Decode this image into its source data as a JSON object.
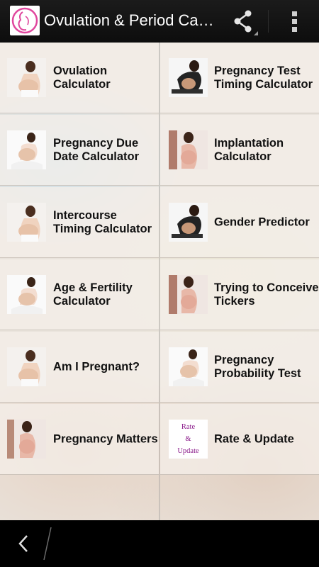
{
  "app": {
    "title": "Ovulation & Period Calculator",
    "icons": {
      "app": "pregnant-woman-logo-icon",
      "share": "share-icon",
      "overflow": "overflow-menu-icon",
      "back": "back-icon"
    }
  },
  "menu": {
    "items": [
      {
        "label": "Ovulation Calculator",
        "thumb": "pregnant-woman-photo"
      },
      {
        "label": "Pregnancy Test Timing Calculator",
        "thumb": "pregnant-woman-dark-photo"
      },
      {
        "label": "Pregnancy Due Date Calculator",
        "thumb": "pregnant-woman-sitting-photo"
      },
      {
        "label": "Implantation Calculator",
        "thumb": "pregnant-woman-photo"
      },
      {
        "label": "Intercourse Timing Calculator",
        "thumb": "pregnant-woman-photo"
      },
      {
        "label": "Gender Predictor",
        "thumb": "pregnant-woman-dark-photo"
      },
      {
        "label": "Age & Fertility Calculator",
        "thumb": "pregnant-woman-sitting-photo"
      },
      {
        "label": "Trying to Conceive Tickers",
        "thumb": "pregnant-woman-photo"
      },
      {
        "label": "Am I Pregnant?",
        "thumb": "pregnant-woman-photo"
      },
      {
        "label": "Pregnancy Probability Test",
        "thumb": "pregnant-woman-sitting-photo"
      },
      {
        "label": "Pregnancy Matters",
        "thumb": "pregnant-woman-photo"
      },
      {
        "label": "Rate & Update",
        "thumb_text": [
          "Rate",
          "&",
          "Update"
        ]
      }
    ]
  },
  "colors": {
    "action_bar": "#1b1b1b",
    "rate_text": "#8a1a8a",
    "app_icon_accent": "#e0479e"
  }
}
